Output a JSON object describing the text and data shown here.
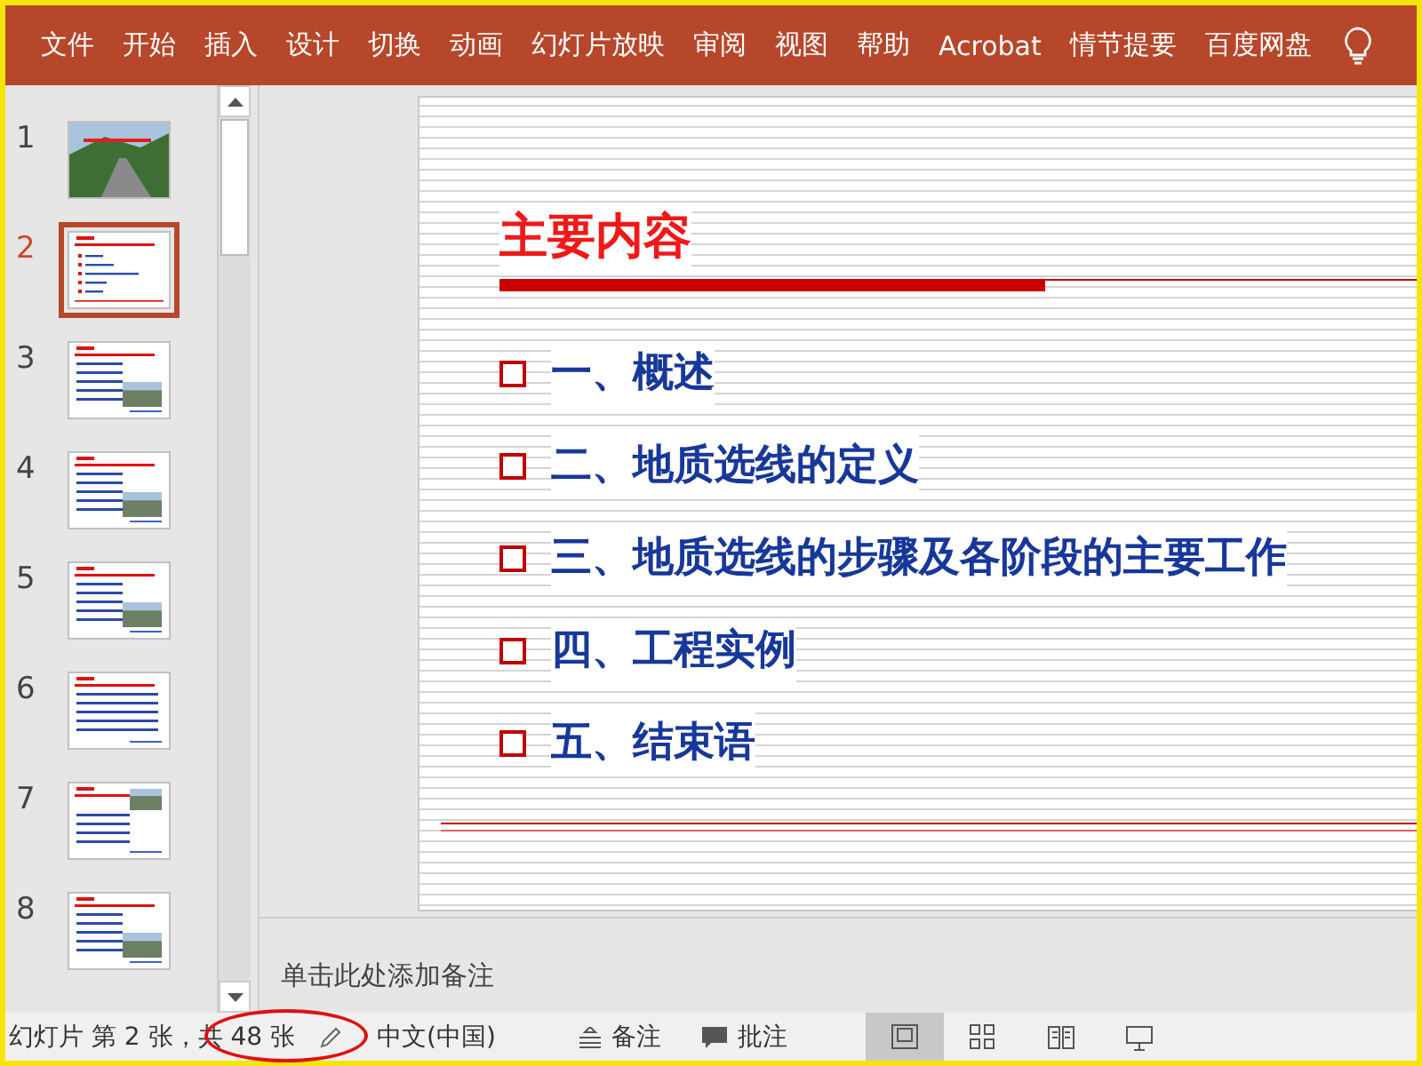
{
  "ribbon": {
    "tabs": [
      {
        "label": "文件",
        "selected": false
      },
      {
        "label": "开始",
        "selected": false
      },
      {
        "label": "插入",
        "selected": false
      },
      {
        "label": "设计",
        "selected": false
      },
      {
        "label": "切换",
        "selected": false
      },
      {
        "label": "动画",
        "selected": false
      },
      {
        "label": "幻灯片放映",
        "selected": false
      },
      {
        "label": "审阅",
        "selected": false
      },
      {
        "label": "视图",
        "selected": false
      },
      {
        "label": "帮助",
        "selected": false
      },
      {
        "label": "Acrobat",
        "selected": false
      },
      {
        "label": "情节提要",
        "selected": false
      },
      {
        "label": "百度网盘",
        "selected": false
      }
    ]
  },
  "thumbnails": [
    {
      "number": "1",
      "kind": "photo",
      "selected": false
    },
    {
      "number": "2",
      "kind": "list",
      "selected": true
    },
    {
      "number": "3",
      "kind": "text-photo",
      "selected": false
    },
    {
      "number": "4",
      "kind": "text-photo",
      "selected": false
    },
    {
      "number": "5",
      "kind": "text-photo",
      "selected": false
    },
    {
      "number": "6",
      "kind": "text",
      "selected": false
    },
    {
      "number": "7",
      "kind": "photo-text",
      "selected": false
    },
    {
      "number": "8",
      "kind": "text-photo",
      "selected": false
    }
  ],
  "slide": {
    "title": "主要内容",
    "items": [
      "一、概述",
      "二、地质选线的定义",
      "三、地质选线的步骤及各阶段的主要工作",
      "四、工程实例",
      "五、结束语"
    ]
  },
  "notes": {
    "placeholder": "单击此处添加备注"
  },
  "status_bar": {
    "slide_info": "幻灯片 第 2 张，共 48 张",
    "language": "中文(中国)",
    "notes_button": "备注",
    "comments_button": "批注",
    "views": [
      {
        "kind": "normal",
        "selected": true
      },
      {
        "kind": "sorter",
        "selected": false
      },
      {
        "kind": "reading",
        "selected": false
      },
      {
        "kind": "slideshow",
        "selected": false
      }
    ]
  }
}
